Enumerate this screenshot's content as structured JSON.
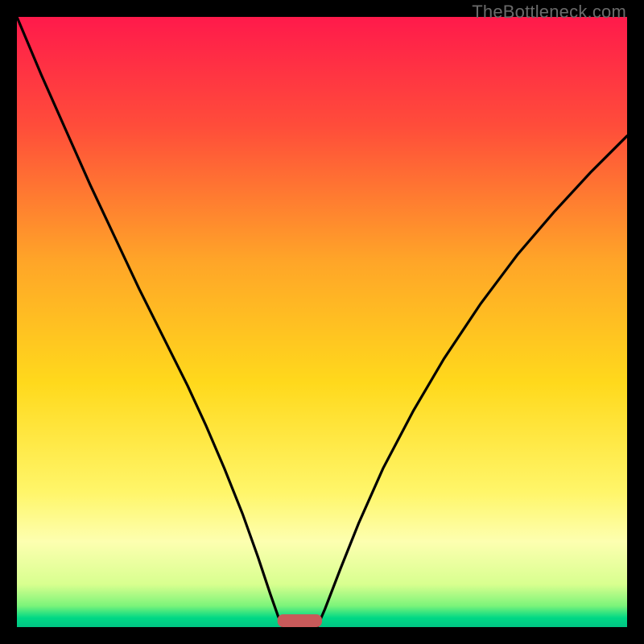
{
  "watermark": "TheBottleneck.com",
  "chart_data": {
    "type": "line",
    "title": "",
    "xlabel": "",
    "ylabel": "",
    "xlim": [
      0,
      1
    ],
    "ylim": [
      0,
      1
    ],
    "gradient_stops": [
      {
        "offset": 0.0,
        "color": "#ff1a4b"
      },
      {
        "offset": 0.18,
        "color": "#ff4d3a"
      },
      {
        "offset": 0.4,
        "color": "#ffa528"
      },
      {
        "offset": 0.6,
        "color": "#ffd91c"
      },
      {
        "offset": 0.78,
        "color": "#fff66a"
      },
      {
        "offset": 0.86,
        "color": "#fdffb0"
      },
      {
        "offset": 0.93,
        "color": "#d8ff8f"
      },
      {
        "offset": 0.965,
        "color": "#7cf47a"
      },
      {
        "offset": 0.985,
        "color": "#00d885"
      },
      {
        "offset": 1.0,
        "color": "#00c583"
      }
    ],
    "series": [
      {
        "name": "left-curve",
        "points": [
          [
            0.0,
            1.0
          ],
          [
            0.04,
            0.905
          ],
          [
            0.08,
            0.815
          ],
          [
            0.12,
            0.725
          ],
          [
            0.16,
            0.64
          ],
          [
            0.2,
            0.555
          ],
          [
            0.24,
            0.475
          ],
          [
            0.28,
            0.395
          ],
          [
            0.31,
            0.33
          ],
          [
            0.34,
            0.26
          ],
          [
            0.37,
            0.185
          ],
          [
            0.395,
            0.115
          ],
          [
            0.415,
            0.055
          ],
          [
            0.428,
            0.018
          ],
          [
            0.436,
            0.0
          ]
        ]
      },
      {
        "name": "right-curve",
        "points": [
          [
            0.492,
            0.0
          ],
          [
            0.505,
            0.03
          ],
          [
            0.53,
            0.095
          ],
          [
            0.56,
            0.17
          ],
          [
            0.6,
            0.26
          ],
          [
            0.65,
            0.355
          ],
          [
            0.7,
            0.44
          ],
          [
            0.76,
            0.53
          ],
          [
            0.82,
            0.61
          ],
          [
            0.88,
            0.68
          ],
          [
            0.94,
            0.745
          ],
          [
            1.0,
            0.805
          ]
        ]
      }
    ],
    "marker": {
      "x_start": 0.427,
      "x_end": 0.5,
      "y": 0.0,
      "thickness_frac": 0.021,
      "color": "#c85a5a"
    }
  }
}
